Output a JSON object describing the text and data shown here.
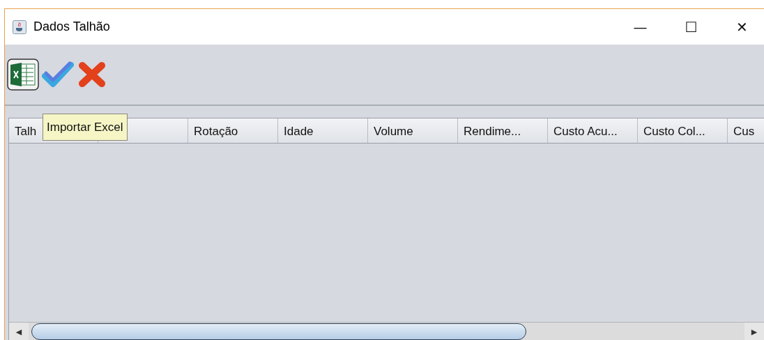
{
  "window": {
    "title": "Dados Talhão",
    "controls": [
      "—",
      "☐",
      "✕"
    ]
  },
  "tooltip": {
    "text": "Importar Excel"
  },
  "table": {
    "columns": [
      "Talh",
      "Rotação",
      "Idade",
      "Volume",
      "Rendime...",
      "Custo Acu...",
      "Custo Col...",
      "Cus"
    ]
  },
  "scroll_arrows": [
    "◀",
    "▶"
  ]
}
